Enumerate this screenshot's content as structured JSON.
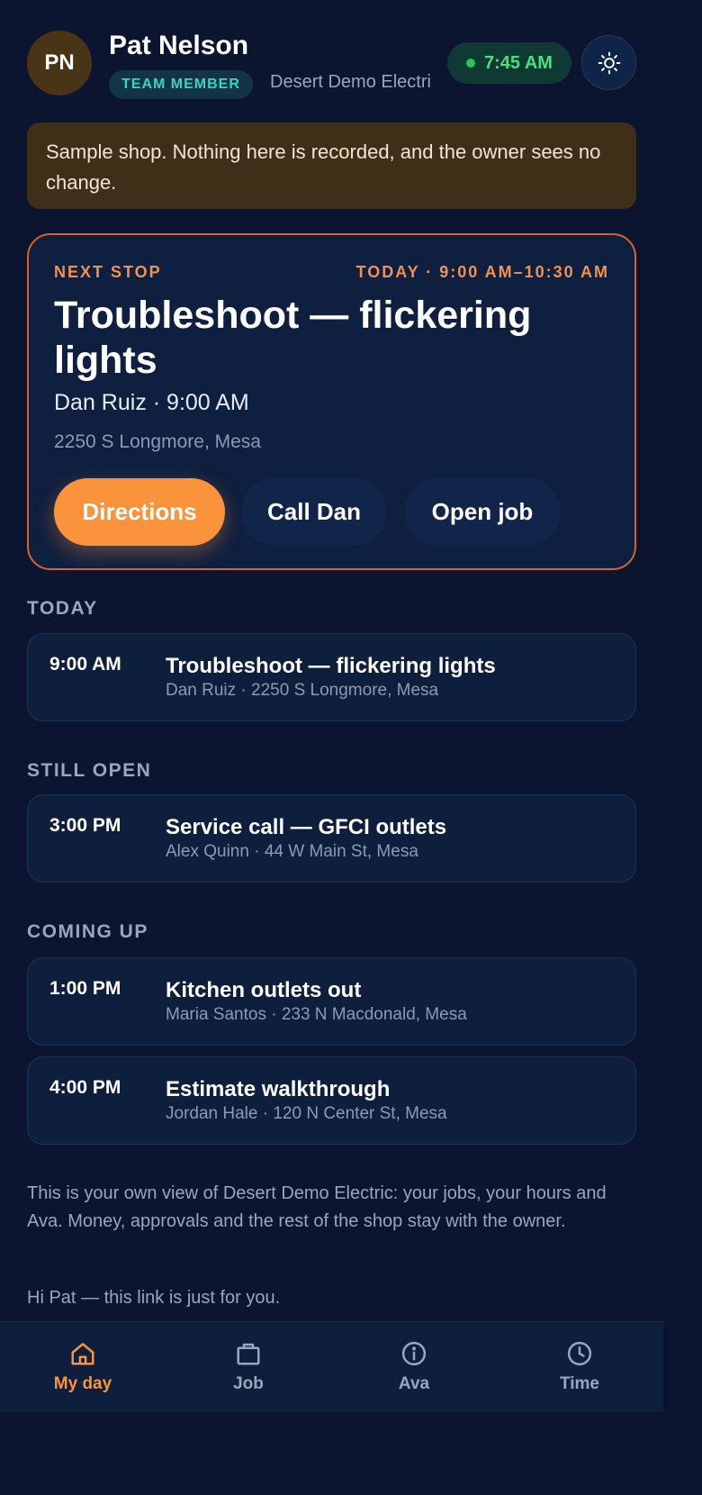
{
  "header": {
    "avatar_initials": "PN",
    "user_name": "Pat Nelson",
    "role": "TEAM MEMBER",
    "company": "Desert Demo Electric",
    "clock_time": "7:45 AM",
    "theme_icon": "sun-icon"
  },
  "banner": {
    "text": "Sample shop. Nothing here is recorded, and the owner sees no change."
  },
  "next_stop": {
    "label": "NEXT STOP",
    "when": "TODAY · 9:00 AM–10:30 AM",
    "title": "Troubleshoot — flickering lights",
    "meta": "Dan Ruiz · 9:00 AM",
    "address": "2250 S Longmore, Mesa",
    "directions_label": "Directions",
    "call_label": "Call Dan",
    "open_label": "Open job"
  },
  "sections": {
    "today": {
      "title": "TODAY",
      "jobs": [
        {
          "time": "9:00 AM",
          "title": "Troubleshoot — flickering lights",
          "sub": "Dan Ruiz · 2250 S Longmore, Mesa"
        }
      ]
    },
    "still_open": {
      "title": "STILL OPEN",
      "jobs": [
        {
          "time": "3:00 PM",
          "title": "Service call — GFCI outlets",
          "sub": "Alex Quinn · 44 W Main St, Mesa"
        }
      ]
    },
    "coming_up": {
      "title": "COMING UP",
      "jobs": [
        {
          "time": "1:00 PM",
          "title": "Kitchen outlets out",
          "sub": "Maria Santos · 233 N Macdonald, Mesa"
        },
        {
          "time": "4:00 PM",
          "title": "Estimate walkthrough",
          "sub": "Jordan Hale · 120 N Center St, Mesa"
        }
      ]
    }
  },
  "footer": {
    "note": "This is your own view of Desert Demo Electric: your jobs, your hours and Ava. Money, approvals and the rest of the shop stay with the owner.",
    "greeting": "Hi Pat — this link is just for you."
  },
  "nav": {
    "items": [
      {
        "label": "My day",
        "icon": "home-icon",
        "active": true
      },
      {
        "label": "Job",
        "icon": "briefcase-icon",
        "active": false
      },
      {
        "label": "Ava",
        "icon": "info-icon",
        "active": false
      },
      {
        "label": "Time",
        "icon": "clock-icon",
        "active": false
      }
    ]
  },
  "colors": {
    "background": "#0b1530",
    "accent": "#fb923c",
    "next_stop_border": "#d9622b",
    "clock_green": "#4ade80",
    "role_teal": "#38d3c5"
  }
}
